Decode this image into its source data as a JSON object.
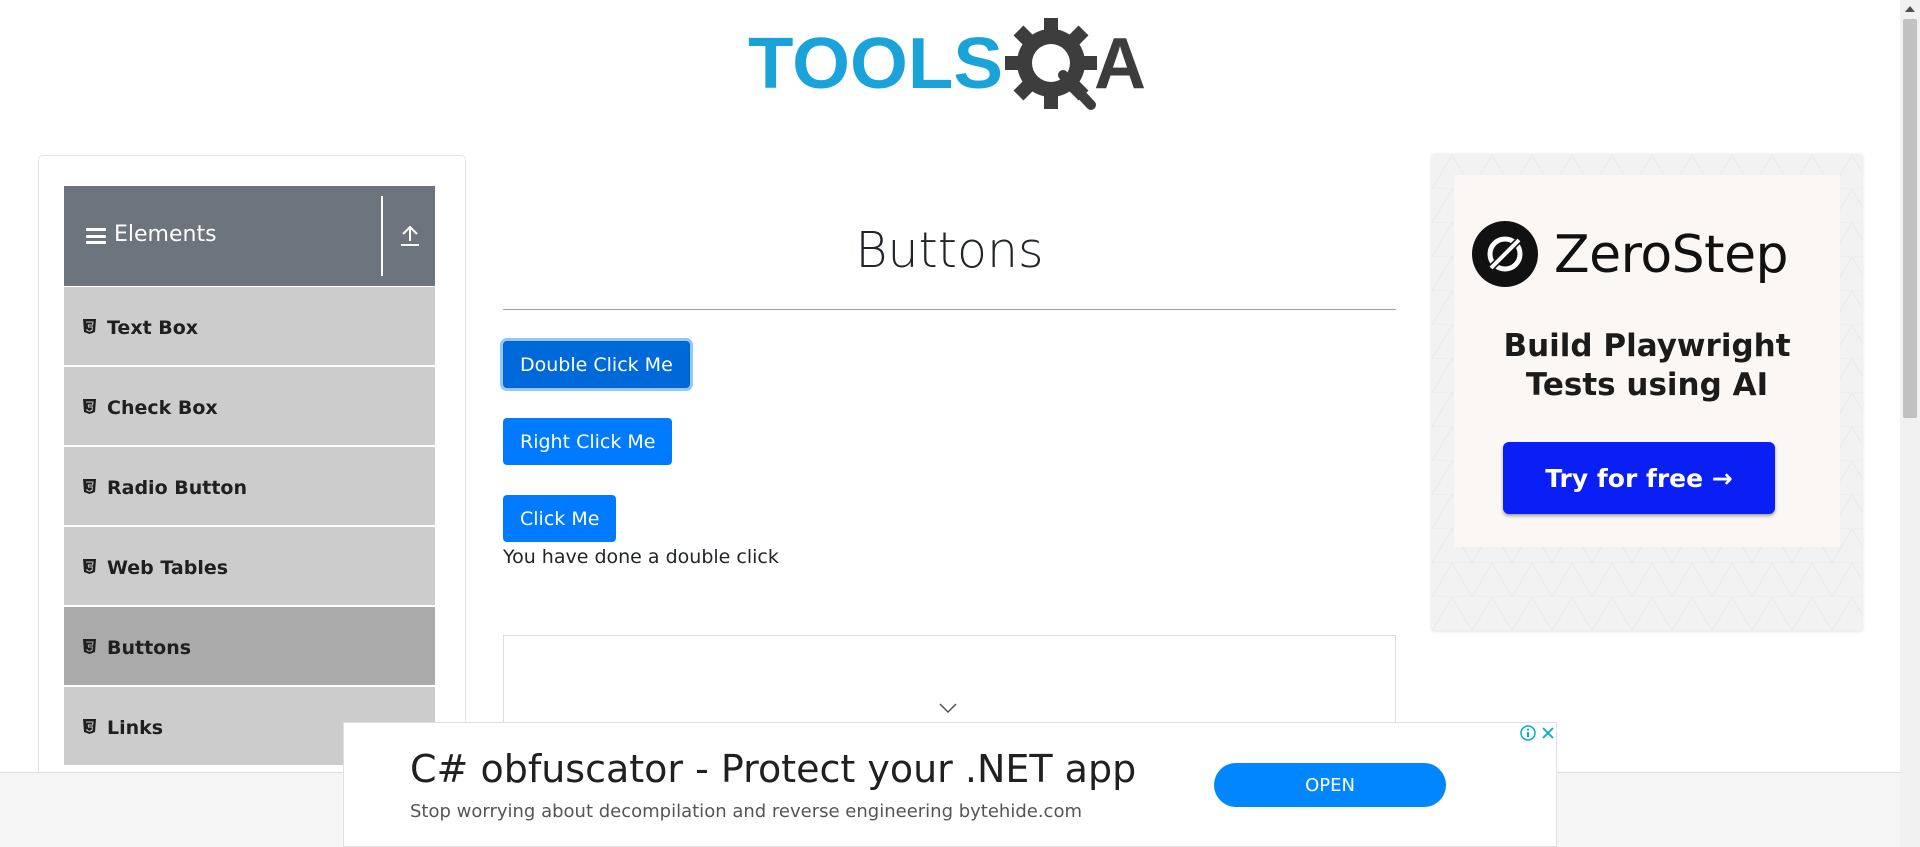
{
  "logo": {
    "part1": "TOOLS",
    "part2": "QA"
  },
  "sidebar": {
    "group_title": "Elements",
    "items": [
      {
        "label": "Text Box",
        "active": false
      },
      {
        "label": "Check Box",
        "active": false
      },
      {
        "label": "Radio Button",
        "active": false
      },
      {
        "label": "Web Tables",
        "active": false
      },
      {
        "label": "Buttons",
        "active": true
      },
      {
        "label": "Links",
        "active": false
      }
    ]
  },
  "main": {
    "title": "Buttons",
    "buttons": {
      "double_click": "Double Click Me",
      "right_click": "Right Click Me",
      "click": "Click Me"
    },
    "message": "You have done a double click"
  },
  "ad_right": {
    "brand": "ZeroStep",
    "tagline_line1": "Build Playwright",
    "tagline_line2": "Tests using AI",
    "cta": "Try for free →"
  },
  "ad_bottom": {
    "headline": "C# obfuscator - Protect your .NET app",
    "subtext": "Stop worrying about decompilation and reverse engineering bytehide.com",
    "button": "OPEN"
  },
  "colors": {
    "primary": "#007bff",
    "sidebar_header": "#6c757d",
    "menu_bg": "#cccccc",
    "menu_active": "#aaaaaa",
    "logo_blue": "#1aa3d9",
    "logo_gray": "#3d3d3d",
    "zerostep_cta": "#0a1ff5"
  }
}
